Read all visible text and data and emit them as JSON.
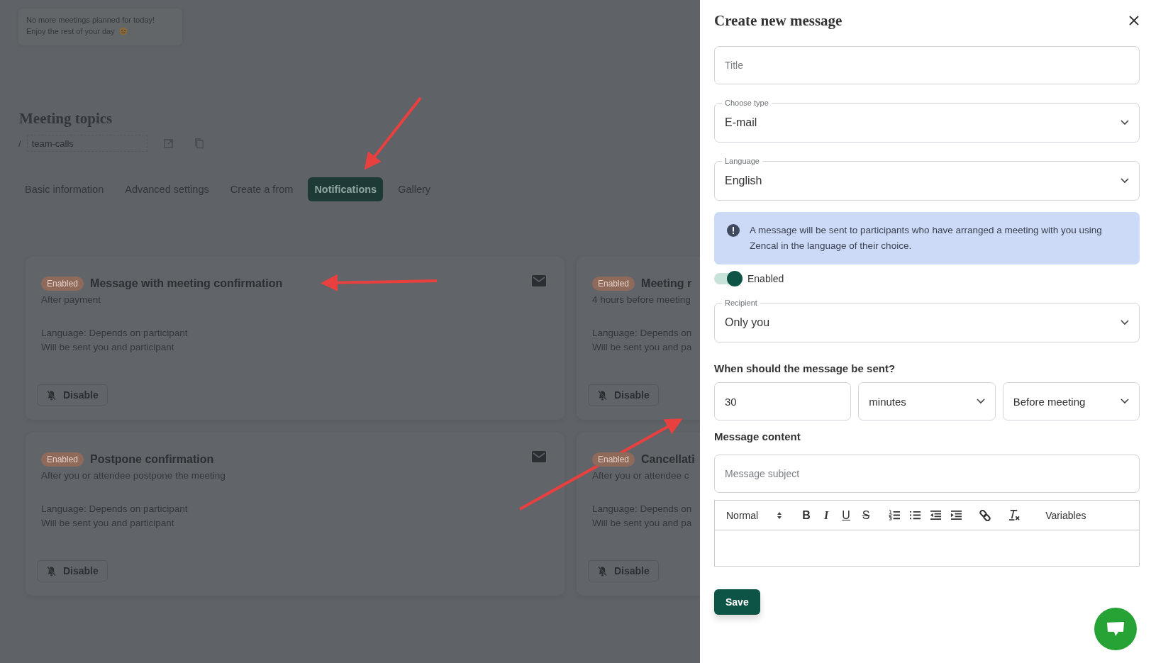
{
  "notice": {
    "lines": [
      "No more meetings planned for today!",
      "Enjoy the rest of your day"
    ]
  },
  "page": {
    "title": "Meeting topics",
    "slug_prefix": "/",
    "slug": "team-calls"
  },
  "tabs": [
    {
      "label": "Basic information",
      "selected": false
    },
    {
      "label": "Advanced settings",
      "selected": false
    },
    {
      "label": "Create a from",
      "selected": false
    },
    {
      "label": "Notifications",
      "selected": true
    },
    {
      "label": "Gallery",
      "selected": false
    }
  ],
  "cards": [
    {
      "status": "Enabled",
      "title": "Message with meeting confirmation",
      "timing": "After payment",
      "language": "Language: Depends on participant",
      "recipients": "Will be sent you and participant",
      "action": "Disable"
    },
    {
      "status": "Enabled",
      "title": "Meeting r",
      "timing": "4 hours before meeting",
      "language": "Language: Depends on",
      "recipients": "Will be sent you and pa",
      "action": "Disable"
    },
    {
      "status": "Enabled",
      "title": "Postpone confirmation",
      "timing": "After you or attendee postpone the meeting",
      "language": "Language: Depends on participant",
      "recipients": "Will be sent you and participant",
      "action": "Disable"
    },
    {
      "status": "Enabled",
      "title": "Cancellati",
      "timing": "After you or attendee c",
      "language": "Language: Depends on",
      "recipients": "Will be sent you and pa",
      "action": "Disable"
    }
  ],
  "panel": {
    "title": "Create new message",
    "title_placeholder": "Title",
    "type": {
      "label": "Choose type",
      "value": "E-mail"
    },
    "language": {
      "label": "Language",
      "value": "English"
    },
    "info": "A message will be sent to participants who have arranged a meeting with you using Zencal in the language of their choice.",
    "toggle": {
      "label": "Enabled",
      "on": true
    },
    "recipient": {
      "label": "Recipient",
      "value": "Only you"
    },
    "timing_heading": "When should the message be sent?",
    "delay": "30",
    "unit": "minutes",
    "relation": "Before meeting",
    "content_heading": "Message content",
    "subject_placeholder": "Message subject",
    "editor": {
      "format": "Normal",
      "tools": [
        {
          "kind": "bold",
          "label": "B"
        },
        {
          "kind": "italic",
          "label": "I"
        },
        {
          "kind": "underline",
          "label": "U"
        },
        {
          "kind": "strike",
          "label": "S"
        },
        {
          "kind": "ordered-list"
        },
        {
          "kind": "bullet-list"
        },
        {
          "kind": "outdent"
        },
        {
          "kind": "indent"
        },
        {
          "kind": "link"
        },
        {
          "kind": "clear-format"
        }
      ],
      "variables": "Variables"
    },
    "save": "Save"
  }
}
